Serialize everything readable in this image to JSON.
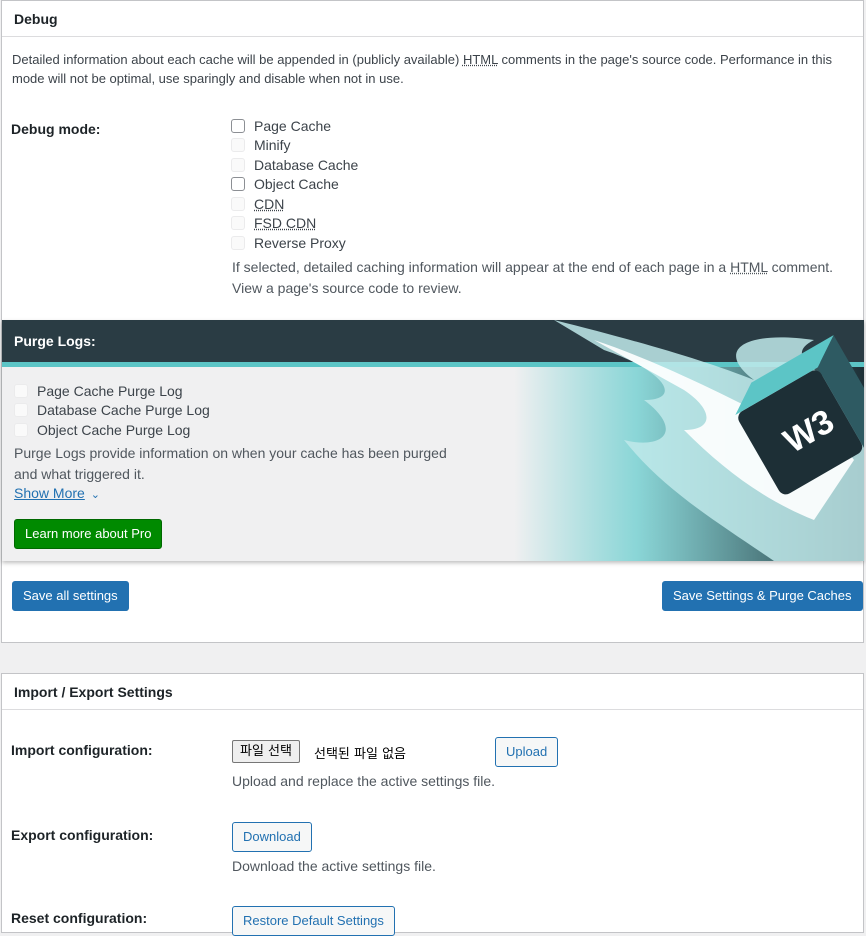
{
  "debug": {
    "title": "Debug",
    "description_1": "Detailed information about each cache will be appended in (publicly available) ",
    "description_abbr": "HTML",
    "description_2": " comments in the page's source code. Performance in this mode will not be optimal, use sparingly and disable when not in use.",
    "mode_label": "Debug mode:",
    "options": [
      {
        "label": "Page Cache",
        "enabled": true
      },
      {
        "label": "Minify",
        "enabled": false
      },
      {
        "label": "Database Cache",
        "enabled": false
      },
      {
        "label": "Object Cache",
        "enabled": true
      },
      {
        "label": "CDN",
        "enabled": false
      },
      {
        "label": "FSD CDN",
        "enabled": false
      },
      {
        "label": "Reverse Proxy",
        "enabled": false
      }
    ],
    "help_1": "If selected, detailed caching information will appear at the end of each page in a ",
    "help_abbr": "HTML",
    "help_2": " comment. View a page's source code to review."
  },
  "purge": {
    "title": "Purge Logs:",
    "options": [
      "Page Cache Purge Log",
      "Database Cache Purge Log",
      "Object Cache Purge Log"
    ],
    "description": "Purge Logs provide information on when your cache has been purged and what triggered it.",
    "show_more": "Show More",
    "pro_button": "Learn more about Pro",
    "logo_text": "W3"
  },
  "actions": {
    "save_all": "Save all settings",
    "save_purge": "Save Settings & Purge Caches"
  },
  "import_export": {
    "title": "Import / Export Settings",
    "import_label": "Import configuration:",
    "file_button": "파일 선택",
    "file_status": "선택된 파일 없음",
    "upload_button": "Upload",
    "upload_help": "Upload and replace the active settings file.",
    "export_label": "Export configuration:",
    "download_button": "Download",
    "download_help": "Download the active settings file.",
    "reset_label": "Reset configuration:",
    "reset_button": "Restore Default Settings"
  },
  "colors": {
    "primary": "#2271b1",
    "green": "#008a00",
    "banner_dark": "#2a3c44",
    "banner_teal": "#5cc5c6"
  }
}
